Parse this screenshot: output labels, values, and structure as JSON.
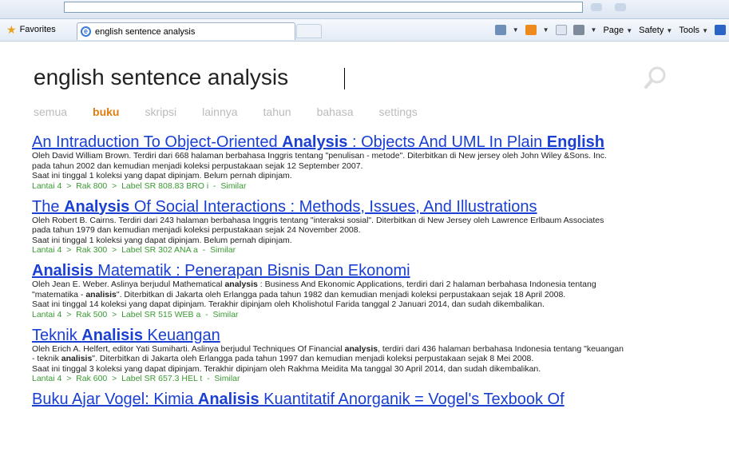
{
  "browser": {
    "favorites_label": "Favorites",
    "tab_title": "english sentence analysis",
    "tools": {
      "page": "Page",
      "safety": "Safety",
      "tools": "Tools"
    }
  },
  "search": {
    "query": "english sentence analysis"
  },
  "filters": [
    {
      "label": "semua",
      "active": false
    },
    {
      "label": "buku",
      "active": true
    },
    {
      "label": "skripsi",
      "active": false
    },
    {
      "label": "lainnya",
      "active": false
    },
    {
      "label": "tahun",
      "active": false
    },
    {
      "label": "bahasa",
      "active": false
    },
    {
      "label": "settings",
      "active": false
    }
  ],
  "results": [
    {
      "title_parts": [
        "An Intraduction To Object-Oriented ",
        "Analysis",
        " : Objects And UML In Plain ",
        "English"
      ],
      "desc": [
        [
          "Oleh David William Brown. Terdiri dari 668 halaman berbahasa Inggris tentang \"penulisan - metode\". Diterbitkan di New jersey oleh John Wiley &Sons. Inc."
        ],
        [
          "pada tahun 2002 dan kemudian menjadi koleksi perpustakaan sejak 12 September 2007."
        ],
        [
          "Saat ini tinggal 1 koleksi yang dapat dipinjam. Belum pernah dipinjam."
        ]
      ],
      "location": "Lantai 4  >  Rak 800  >  Label SR 808.83 BRO i",
      "similar": "Similar"
    },
    {
      "title_parts": [
        "The ",
        "Analysis",
        " Of Social Interactions : Methods, Issues, And Illustrations"
      ],
      "desc": [
        [
          "Oleh Robert B. Cairns. Terdiri dari 243 halaman berbahasa Inggris tentang \"interaksi sosial\". Diterbitkan di New Jersey oleh Lawrence Erlbaum Associates"
        ],
        [
          "pada tahun 1979 dan kemudian menjadi koleksi perpustakaan sejak 24 November 2008."
        ],
        [
          "Saat ini tinggal 1 koleksi yang dapat dipinjam. Belum pernah dipinjam."
        ]
      ],
      "location": "Lantai 4  >  Rak 300  >  Label SR 302 ANA a",
      "similar": "Similar"
    },
    {
      "title_parts": [
        "",
        "Analisis",
        " Matematik : Penerapan Bisnis Dan Ekonomi"
      ],
      "desc": [
        [
          "Oleh Jean E. Weber. Aslinya berjudul Mathematical ",
          "analysis",
          " : Business And Ekonomic Applications, terdiri dari 2 halaman berbahasa Indonesia tentang"
        ],
        [
          "\"matematika - ",
          "analisis",
          "\". Diterbitkan di Jakarta oleh Erlangga pada tahun 1982 dan kemudian menjadi koleksi perpustakaan sejak 18 April 2008."
        ],
        [
          "Saat ini tinggal 14 koleksi yang dapat dipinjam. Terakhir dipinjam oleh Kholishotul Farida tanggal 2 Januari 2014, dan sudah dikembalikan."
        ]
      ],
      "location": "Lantai 4  >  Rak 500  >  Label SR 515 WEB a",
      "similar": "Similar"
    },
    {
      "title_parts": [
        "Teknik ",
        "Analisis",
        " Keuangan"
      ],
      "desc": [
        [
          "Oleh Erich A. Helfert, editor Yati Sumiharti. Aslinya berjudul Techniques Of Financial ",
          "analysis",
          ", terdiri dari 436 halaman berbahasa Indonesia tentang \"keuangan"
        ],
        [
          "- teknik ",
          "analisis",
          "\". Diterbitkan di Jakarta oleh Erlangga pada tahun 1997 dan kemudian menjadi koleksi perpustakaan sejak 8 Mei 2008."
        ],
        [
          "Saat ini tinggal 3 koleksi yang dapat dipinjam. Terakhir dipinjam oleh Rakhma Meidita Ma tanggal 30 April 2014, dan sudah dikembalikan."
        ]
      ],
      "location": "Lantai 4  >  Rak 600  >  Label SR 657.3 HEL t",
      "similar": "Similar"
    },
    {
      "title_parts": [
        "Buku Ajar Vogel: Kimia ",
        "Analisis",
        " Kuantitatif Anorganik = Vogel's Texbook Of"
      ],
      "desc": [],
      "location": "",
      "similar": ""
    }
  ]
}
